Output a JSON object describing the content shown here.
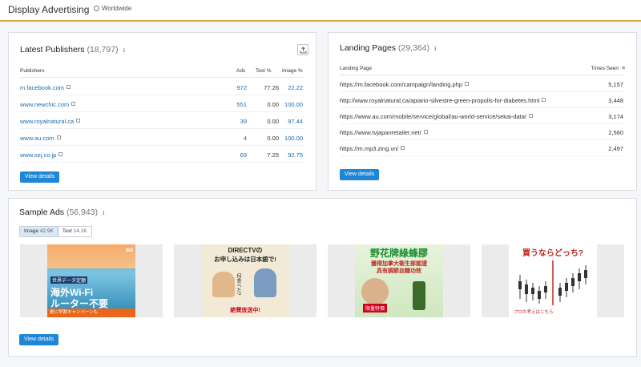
{
  "header": {
    "title": "Display Advertising",
    "geo": "Worldwide"
  },
  "publishers": {
    "title": "Latest Publishers",
    "count": "(18,797)",
    "columns": [
      "Publishers",
      "Ads",
      "Text %",
      "Image %"
    ],
    "rows": [
      {
        "name": "m.facebook.com",
        "ads": "972",
        "text": "77.26",
        "image": "22.22"
      },
      {
        "name": "www.newchic.com",
        "ads": "551",
        "text": "0.00",
        "image": "100.00"
      },
      {
        "name": "www.royalnatural.ca",
        "ads": "39",
        "text": "0.00",
        "image": "97.44"
      },
      {
        "name": "www.au.com",
        "ads": "4",
        "text": "0.00",
        "image": "100.00"
      },
      {
        "name": "www.sej.co.jp",
        "ads": "69",
        "text": "7.25",
        "image": "92.75"
      }
    ],
    "button": "View details"
  },
  "landing": {
    "title": "Landing Pages",
    "count": "(29,364)",
    "columns": [
      "Landing Page",
      "Times Seen"
    ],
    "rows": [
      {
        "url": "https://m.facebook.com/campaign/landing.php",
        "seen": "5,157"
      },
      {
        "url": "http://www.royalnatural.ca/apiario-silvestre-green-propolis-for-diabetes.html",
        "seen": "3,448"
      },
      {
        "url": "https://www.au.com/mobile/service/global/au-world-service/sekai-data/",
        "seen": "3,174"
      },
      {
        "url": "https://www.tvjapanretailer.net/",
        "seen": "2,560"
      },
      {
        "url": "https://m.mp3.zing.vn/",
        "seen": "2,497"
      }
    ],
    "button": "View details"
  },
  "samples": {
    "title": "Sample Ads",
    "count": "(56,943)",
    "tabs": [
      {
        "label": "Image",
        "count": "42.9K"
      },
      {
        "label": "Text",
        "count": "14.1K"
      }
    ],
    "button": "View details",
    "ads": [
      {
        "brand": "au",
        "top": "世界データ定額",
        "l1": "海外Wi-Fi",
        "l2": "ルーター不要",
        "foot": "更に早割キャンペーンも"
      },
      {
        "l1": "DIRECTVの",
        "l2": "お申し込みは日本語で!",
        "sub": "何食べた?",
        "foot": "絶賛放送中!"
      },
      {
        "l1": "野花牌綠蜂膠",
        "l2": "獲得加拿大衛生部認證",
        "l3": "具有調節血糖功效",
        "badge": "限量特價"
      },
      {
        "l1": "買うならどっち?",
        "foot": "プロの考えはこちら"
      }
    ]
  }
}
